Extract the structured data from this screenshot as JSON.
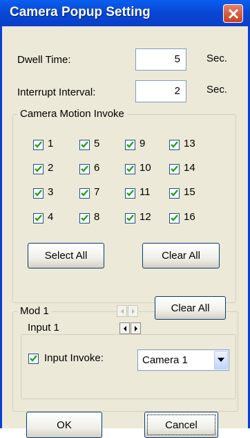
{
  "window": {
    "title": "Camera Popup Setting",
    "close_icon": "close-icon",
    "accent": "#0a3fd8"
  },
  "dwell": {
    "label": "Dwell Time:",
    "value": "5",
    "unit": "Sec."
  },
  "interrupt": {
    "label": "Interrupt Interval:",
    "value": "2",
    "unit": "Sec."
  },
  "motion": {
    "title": "Camera Motion Invoke",
    "cameras": [
      {
        "label": "1",
        "checked": true
      },
      {
        "label": "5",
        "checked": true
      },
      {
        "label": "9",
        "checked": true
      },
      {
        "label": "13",
        "checked": true
      },
      {
        "label": "2",
        "checked": true
      },
      {
        "label": "6",
        "checked": true
      },
      {
        "label": "10",
        "checked": true
      },
      {
        "label": "14",
        "checked": true
      },
      {
        "label": "3",
        "checked": true
      },
      {
        "label": "7",
        "checked": true
      },
      {
        "label": "11",
        "checked": true
      },
      {
        "label": "15",
        "checked": true
      },
      {
        "label": "4",
        "checked": true
      },
      {
        "label": "8",
        "checked": true
      },
      {
        "label": "12",
        "checked": true
      },
      {
        "label": "16",
        "checked": true
      }
    ],
    "select_all": "Select All",
    "clear_all": "Clear All"
  },
  "mod": {
    "title": "Mod 1",
    "clear_all": "Clear All",
    "input": {
      "title": "Input 1",
      "invoke_label": "Input Invoke:",
      "invoke_checked": true,
      "camera_selected": "Camera 1"
    }
  },
  "buttons": {
    "ok": "OK",
    "cancel": "Cancel"
  }
}
